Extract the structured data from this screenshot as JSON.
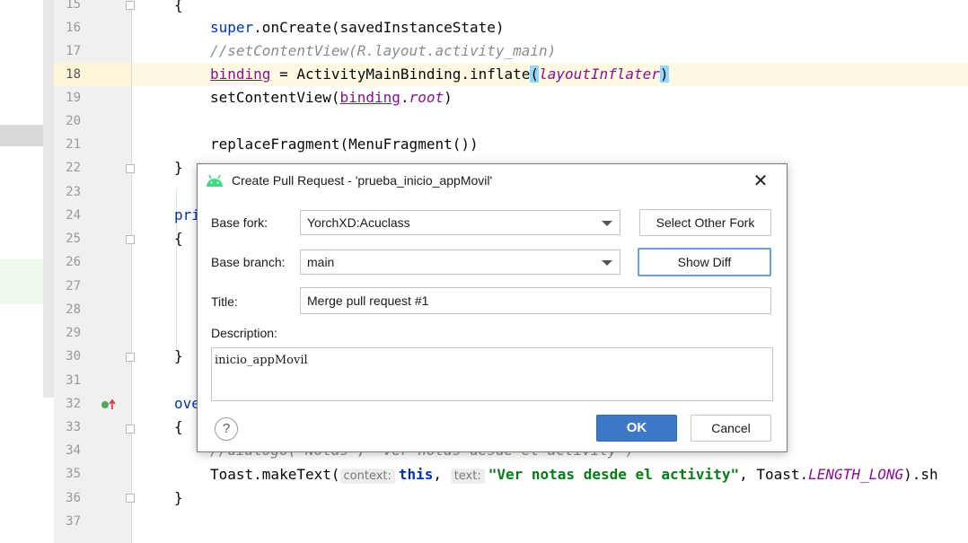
{
  "editor": {
    "line_numbers": [
      "15",
      "16",
      "17",
      "18",
      "19",
      "20",
      "21",
      "22",
      "23",
      "24",
      "25",
      "26",
      "27",
      "28",
      "29",
      "30",
      "31",
      "32",
      "33",
      "34",
      "35",
      "36",
      "37"
    ],
    "lines": {
      "l15": "{",
      "l16_kw": "super",
      "l16_rest": ".onCreate(savedInstanceState)",
      "l17": "//setContentView(R.layout.activity_main)",
      "l18_var": "binding",
      "l18_mid": " = ActivityMainBinding.inflate",
      "l18_open": "(",
      "l18_arg": "layoutInflater",
      "l18_close": ")",
      "l19_pre": "setContentView(",
      "l19_var": "binding",
      "l19_dot": ".",
      "l19_prop": "root",
      "l19_end": ")",
      "l21": "replaceFragment(MenuFragment())",
      "l22": "}",
      "l24": "pri",
      "l25": "{",
      "l30": "}",
      "l32": "ove",
      "l33": "{",
      "l34": "//dialogo(\"Notas\", \"Ver notas desde el activity\")",
      "l35_pre": "Toast.makeText(",
      "l35_hint1": "context:",
      "l35_this": "this",
      "l35_comma": ", ",
      "l35_hint2": "text:",
      "l35_str": "\"Ver notas desde el activity\"",
      "l35_mid": ", Toast.",
      "l35_const": "LENGTH_LONG",
      "l35_end": ").sh",
      "l36": "}"
    }
  },
  "dialog": {
    "title": "Create Pull Request - 'prueba_inicio_appMovil'",
    "close_icon": "close-icon",
    "base_fork_label": "Base fork:",
    "base_fork_value": "YorchXD:Acuclass",
    "select_other_fork": "Select Other Fork",
    "base_branch_label": "Base branch:",
    "base_branch_value": "main",
    "show_diff": "Show Diff",
    "title_label": "Title:",
    "title_value": "Merge pull request #1",
    "description_label": "Description:",
    "description_value": "inicio_appMovil",
    "help": "?",
    "ok": "OK",
    "cancel": "Cancel"
  }
}
